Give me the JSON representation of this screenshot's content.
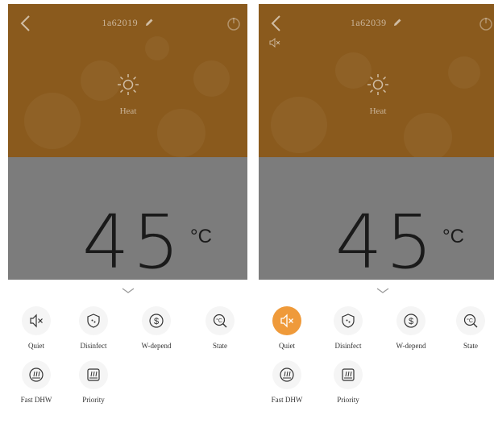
{
  "colors": {
    "header_brown": "#8a5a1d",
    "temp_gray": "#7c7c7c",
    "active_orange": "#ef9a3a"
  },
  "left": {
    "device_name": "1a62019",
    "mode_label": "Heat",
    "temperature": "45",
    "unit": "°C",
    "buttons": [
      {
        "label": "Quiet",
        "icon": "speaker-muted-icon",
        "active": false
      },
      {
        "label": "Disinfect",
        "icon": "shield-icon",
        "active": false
      },
      {
        "label": "W-depend",
        "icon": "dollar-icon",
        "active": false
      },
      {
        "label": "State",
        "icon": "thermometer-search-icon",
        "active": false
      },
      {
        "label": "Fast DHW",
        "icon": "fast-water-icon",
        "active": false
      },
      {
        "label": "Priority",
        "icon": "priority-water-icon",
        "active": false
      }
    ]
  },
  "right": {
    "device_name": "1a62039",
    "mode_label": "Heat",
    "temperature": "45",
    "unit": "°C",
    "buttons": [
      {
        "label": "Quiet",
        "icon": "speaker-muted-icon",
        "active": true
      },
      {
        "label": "Disinfect",
        "icon": "shield-icon",
        "active": false
      },
      {
        "label": "W-depend",
        "icon": "dollar-icon",
        "active": false
      },
      {
        "label": "State",
        "icon": "thermometer-search-icon",
        "active": false
      },
      {
        "label": "Fast DHW",
        "icon": "fast-water-icon",
        "active": false
      },
      {
        "label": "Priority",
        "icon": "priority-water-icon",
        "active": false
      }
    ]
  }
}
